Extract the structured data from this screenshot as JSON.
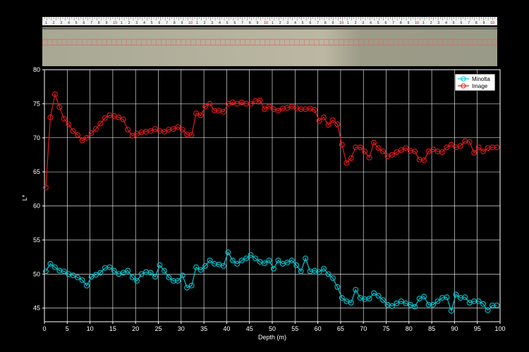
{
  "image_strip": {
    "ruler_digits": [
      "1",
      "2",
      "3",
      "4",
      "5",
      "6",
      "7",
      "8",
      "9",
      "10"
    ]
  },
  "chart_data": {
    "type": "line",
    "xlabel": "Depth (m)",
    "ylabel": "L*",
    "xlim": [
      0,
      100
    ],
    "ylim": [
      43,
      80
    ],
    "xticks": [
      0,
      5,
      10,
      15,
      20,
      25,
      30,
      35,
      40,
      45,
      50,
      55,
      60,
      65,
      70,
      75,
      80,
      85,
      90,
      95,
      100
    ],
    "yticks": [
      45,
      50,
      55,
      60,
      65,
      70,
      75,
      80
    ],
    "grid": true,
    "legend_position": "top-right",
    "series": [
      {
        "name": "Minolta",
        "color": "#00c8d2",
        "x": [
          0.3,
          1.3,
          2.3,
          3.3,
          4.3,
          5.3,
          6.3,
          7.3,
          8.3,
          9.3,
          10.3,
          11.3,
          12.3,
          13.3,
          14.3,
          15.3,
          16.3,
          17.3,
          18.3,
          19.3,
          20.3,
          21.3,
          22.3,
          23.3,
          24.3,
          25.3,
          26.3,
          27.3,
          28.3,
          29.3,
          30.3,
          31.3,
          32.3,
          33.3,
          34.3,
          35.3,
          36.3,
          37.3,
          38.3,
          39.3,
          40.3,
          41.3,
          42.3,
          43.3,
          44.3,
          45.3,
          46.3,
          47.3,
          48.3,
          49.3,
          50.3,
          51.3,
          52.3,
          53.3,
          54.3,
          55.3,
          56.3,
          57.3,
          58.3,
          59.3,
          60.3,
          61.3,
          62.3,
          63.3,
          64.3,
          65.3,
          66.3,
          67.3,
          68.3,
          69.3,
          70.3,
          71.3,
          72.3,
          73.3,
          74.3,
          75.3,
          76.3,
          77.3,
          78.3,
          79.3,
          80.3,
          81.3,
          82.3,
          83.3,
          84.3,
          85.3,
          86.3,
          87.3,
          88.3,
          89.3,
          90.3,
          91.3,
          92.3,
          93.3,
          94.3,
          95.3,
          96.3,
          97.3,
          98.3,
          99.3
        ],
        "y": [
          50.4,
          51.5,
          51.0,
          50.5,
          50.4,
          50.0,
          49.8,
          49.5,
          49.1,
          48.3,
          49.6,
          49.9,
          50.2,
          50.9,
          51.0,
          50.5,
          50.0,
          50.2,
          50.5,
          49.5,
          49.0,
          50.0,
          50.3,
          50.2,
          49.6,
          51.3,
          50.5,
          49.5,
          49.0,
          49.0,
          49.8,
          48.0,
          48.3,
          51.0,
          50.6,
          51.2,
          52.0,
          51.5,
          51.4,
          51.2,
          53.2,
          52.0,
          51.5,
          52.0,
          52.3,
          52.8,
          52.3,
          51.8,
          51.6,
          52.0,
          50.8,
          52.0,
          51.5,
          51.7,
          52.0,
          51.3,
          50.4,
          52.3,
          50.4,
          50.5,
          50.3,
          50.8,
          50.0,
          49.4,
          48.1,
          46.5,
          46.0,
          45.8,
          47.7,
          46.5,
          46.3,
          46.4,
          47.2,
          46.8,
          46.2,
          45.5,
          45.3,
          45.7,
          46.0,
          45.7,
          45.5,
          45.2,
          46.4,
          46.7,
          45.5,
          45.5,
          46.0,
          46.5,
          46.6,
          44.6,
          47.0,
          46.5,
          46.6,
          45.8,
          46.0,
          46.0,
          45.6,
          44.7,
          45.4,
          45.4
        ]
      },
      {
        "name": "Image",
        "color": "#e41a1c",
        "x": [
          0.3,
          1.3,
          2.3,
          3.3,
          4.3,
          5.3,
          6.3,
          7.3,
          8.3,
          9.3,
          10.3,
          11.3,
          12.3,
          13.3,
          14.3,
          15.3,
          16.3,
          17.3,
          18.3,
          19.3,
          20.3,
          21.3,
          22.3,
          23.3,
          24.3,
          25.3,
          26.3,
          27.3,
          28.3,
          29.3,
          30.3,
          31.3,
          32.3,
          33.3,
          34.3,
          35.3,
          36.3,
          37.3,
          38.3,
          39.3,
          40.3,
          41.3,
          42.3,
          43.3,
          44.3,
          45.3,
          46.3,
          47.3,
          48.3,
          49.3,
          50.3,
          51.3,
          52.3,
          53.3,
          54.3,
          55.3,
          56.3,
          57.3,
          58.3,
          59.3,
          60.3,
          61.3,
          62.3,
          63.3,
          64.3,
          65.3,
          66.3,
          67.3,
          68.3,
          69.3,
          70.3,
          71.3,
          72.3,
          73.3,
          74.3,
          75.3,
          76.3,
          77.3,
          78.3,
          79.3,
          80.3,
          81.3,
          82.3,
          83.3,
          84.3,
          85.3,
          86.3,
          87.3,
          88.3,
          89.3,
          90.3,
          91.3,
          92.3,
          93.3,
          94.3,
          95.3,
          96.3,
          97.3,
          98.3,
          99.3
        ],
        "y": [
          62.7,
          73.0,
          76.4,
          74.5,
          72.8,
          72.0,
          71.0,
          70.4,
          69.6,
          70.0,
          70.7,
          71.3,
          72.1,
          72.9,
          73.3,
          73.2,
          73.0,
          72.7,
          71.2,
          70.3,
          70.6,
          70.8,
          70.9,
          71.0,
          71.3,
          71.0,
          70.9,
          71.2,
          71.3,
          71.6,
          71.2,
          70.5,
          70.4,
          73.6,
          73.3,
          74.6,
          75.0,
          74.0,
          74.0,
          73.8,
          75.0,
          75.2,
          75.0,
          75.2,
          75.0,
          75.0,
          75.4,
          75.5,
          74.2,
          74.6,
          74.2,
          74.0,
          74.3,
          74.4,
          74.6,
          74.4,
          74.2,
          74.2,
          74.3,
          74.1,
          72.5,
          73.0,
          71.9,
          72.6,
          72.0,
          69.0,
          66.3,
          67.0,
          68.6,
          68.6,
          68.0,
          67.1,
          69.3,
          68.5,
          68.0,
          67.3,
          67.5,
          67.9,
          68.2,
          68.5,
          68.1,
          68.0,
          66.8,
          66.7,
          68.0,
          68.3,
          68.0,
          67.9,
          68.6,
          69.0,
          68.6,
          68.8,
          69.5,
          69.4,
          67.8,
          68.6,
          68.0,
          68.5,
          68.6,
          68.6
        ]
      }
    ]
  }
}
